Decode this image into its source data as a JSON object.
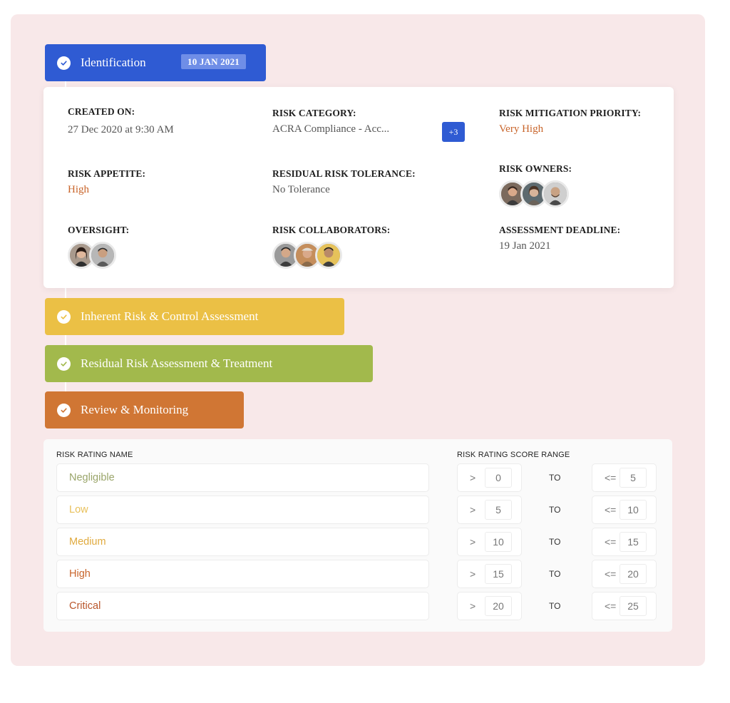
{
  "steps": [
    {
      "label": "Identification",
      "date": "10 JAN 2021"
    },
    {
      "label": "Inherent Risk & Control Assessment"
    },
    {
      "label": "Residual Risk Assessment & Treatment"
    },
    {
      "label": "Review & Monitoring"
    }
  ],
  "details": {
    "created_on": {
      "label": "CREATED ON:",
      "value": "27 Dec 2020 at 9:30 AM"
    },
    "risk_category": {
      "label": "RISK CATEGORY:",
      "value": "ACRA Compliance - Acc...",
      "more": "+3"
    },
    "mitigation_priority": {
      "label": "RISK MITIGATION PRIORITY:",
      "value": "Very High"
    },
    "risk_appetite": {
      "label": "RISK APPETITE:",
      "value": "High"
    },
    "residual_tolerance": {
      "label": "RESIDUAL RISK TOLERANCE:",
      "value": "No Tolerance"
    },
    "risk_owners": {
      "label": "RISK OWNERS:"
    },
    "oversight": {
      "label": "OVERSIGHT:"
    },
    "risk_collaborators": {
      "label": "RISK COLLABORATORS:"
    },
    "assessment_deadline": {
      "label": "ASSESSMENT DEADLINE:",
      "value": "19 Jan 2021"
    }
  },
  "rating_table": {
    "name_header": "RISK RATING NAME",
    "range_header": "RISK RATING SCORE RANGE",
    "to_label": "TO",
    "gt_symbol": ">",
    "lte_symbol": "<=",
    "rows": [
      {
        "name": "Negligible",
        "min": "0",
        "max": "5"
      },
      {
        "name": "Low",
        "min": "5",
        "max": "10"
      },
      {
        "name": "Medium",
        "min": "10",
        "max": "15"
      },
      {
        "name": "High",
        "min": "15",
        "max": "20"
      },
      {
        "name": "Critical",
        "min": "20",
        "max": "25"
      }
    ]
  },
  "colors": {
    "identification": "#2f5bd3",
    "inherent": "#ebc045",
    "residual": "#a2b94c",
    "review": "#d07634",
    "negligible": "#9aa56a",
    "low": "#e8c05a",
    "medium": "#e0aa3e",
    "high": "#c8642a",
    "critical": "#b9552a"
  }
}
